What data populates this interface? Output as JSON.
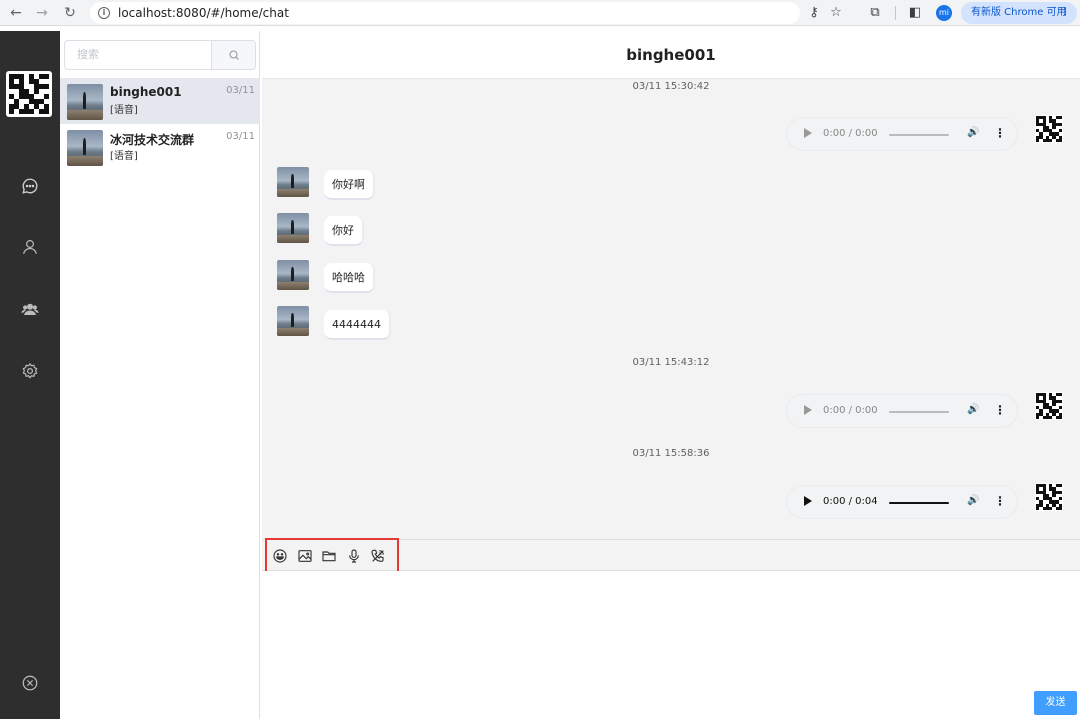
{
  "browser": {
    "url": "localhost:8080/#/home/chat",
    "profile_initial": "mi",
    "update_label": "有新版 Chrome 可用"
  },
  "leftnav": {
    "items": [
      "chat-icon",
      "user-icon",
      "group-icon",
      "settings-icon"
    ],
    "bottom_icon": "close-circle-icon",
    "color": "#2e2e2e"
  },
  "sessions": {
    "search_placeholder": "搜索",
    "items": [
      {
        "name": "binghe001",
        "preview": "[语音]",
        "date": "03/11",
        "active": true
      },
      {
        "name": "冰河技术交流群",
        "preview": "[语音]",
        "date": "03/11",
        "active": false
      }
    ]
  },
  "chat": {
    "title": "binghe001",
    "messages": [
      {
        "type": "time",
        "text": "03/11 15:30:42"
      },
      {
        "type": "audio",
        "side": "right",
        "time": "0:00 / 0:00",
        "loaded": false
      },
      {
        "type": "text",
        "side": "left",
        "text": "你好啊"
      },
      {
        "type": "text",
        "side": "left",
        "text": "你好"
      },
      {
        "type": "text",
        "side": "left",
        "text": "哈哈哈"
      },
      {
        "type": "text",
        "side": "left",
        "text": "4444444"
      },
      {
        "type": "time",
        "text": "03/11 15:43:12"
      },
      {
        "type": "audio",
        "side": "right",
        "time": "0:00 / 0:00",
        "loaded": false
      },
      {
        "type": "time",
        "text": "03/11 15:58:36"
      },
      {
        "type": "audio",
        "side": "right",
        "time": "0:00 / 0:04",
        "loaded": true
      }
    ],
    "toolbar": [
      "emoji-icon",
      "image-icon",
      "folder-icon",
      "microphone-icon",
      "phone-call-icon"
    ],
    "send_label": "发送",
    "accent": "#409eff",
    "highlight": "#e53935"
  }
}
